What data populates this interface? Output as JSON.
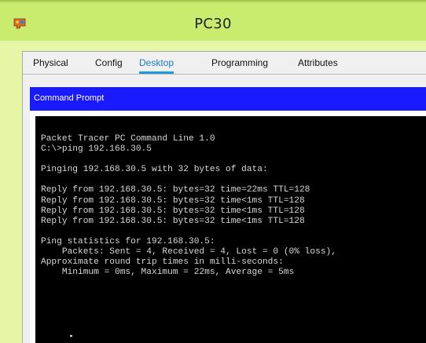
{
  "window": {
    "title": "PC30",
    "icon": "packet-tracer-pc-icon"
  },
  "tabs": [
    {
      "label": "Physical",
      "active": false
    },
    {
      "label": "Config",
      "active": false
    },
    {
      "label": "Desktop",
      "active": true
    },
    {
      "label": "Programming",
      "active": false
    },
    {
      "label": "Attributes",
      "active": false
    }
  ],
  "panel": {
    "title": "Command Prompt"
  },
  "terminal": {
    "lines": [
      "Packet Tracer PC Command Line 1.0",
      "C:\\>ping 192.168.30.5",
      "",
      "Pinging 192.168.30.5 with 32 bytes of data:",
      "",
      "Reply from 192.168.30.5: bytes=32 time=22ms TTL=128",
      "Reply from 192.168.30.5: bytes=32 time<1ms TTL=128",
      "Reply from 192.168.30.5: bytes=32 time<1ms TTL=128",
      "Reply from 192.168.30.5: bytes=32 time<1ms TTL=128",
      "",
      "Ping statistics for 192.168.30.5:",
      "    Packets: Sent = 4, Received = 4, Lost = 0 (0% loss),",
      "Approximate round trip times in milli-seconds:",
      "    Minimum = 0ms, Maximum = 22ms, Average = 5ms"
    ]
  },
  "colors": {
    "title_bar": "#c9eb6e",
    "frame": "#e6f6a6",
    "command_header": "#1a1aff",
    "active_tab": "#1a7dc2",
    "terminal_bg": "#000000",
    "terminal_text": "#d8d8d8"
  }
}
